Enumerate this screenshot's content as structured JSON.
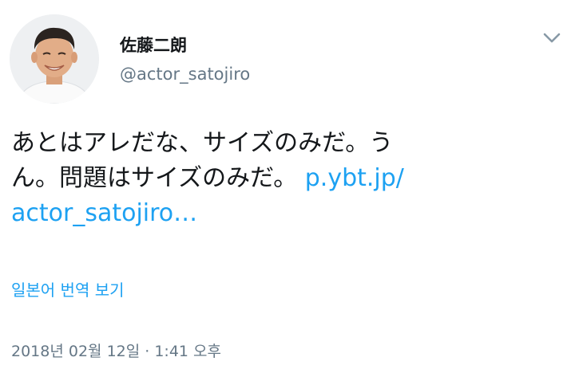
{
  "tweet": {
    "author": {
      "name": "佐藤二朗",
      "handle": "@actor_satojiro",
      "avatar_icon": "user-avatar-photo"
    },
    "menu_icon": "chevron-down-icon",
    "text_line1": "あとはアレだな、サイズのみだ。う",
    "text_line2_plain": "ん。問題はサイズのみだ。 ",
    "link_part1": "p.ybt.jp/",
    "link_part2": "actor_satojiro…",
    "translate_label": "일본어 번역 보기",
    "timestamp": "2018년 02월 12일 · 1:41 오후"
  },
  "colors": {
    "text": "#14171a",
    "secondary": "#657786",
    "link": "#1da1f2",
    "background": "#ffffff"
  }
}
